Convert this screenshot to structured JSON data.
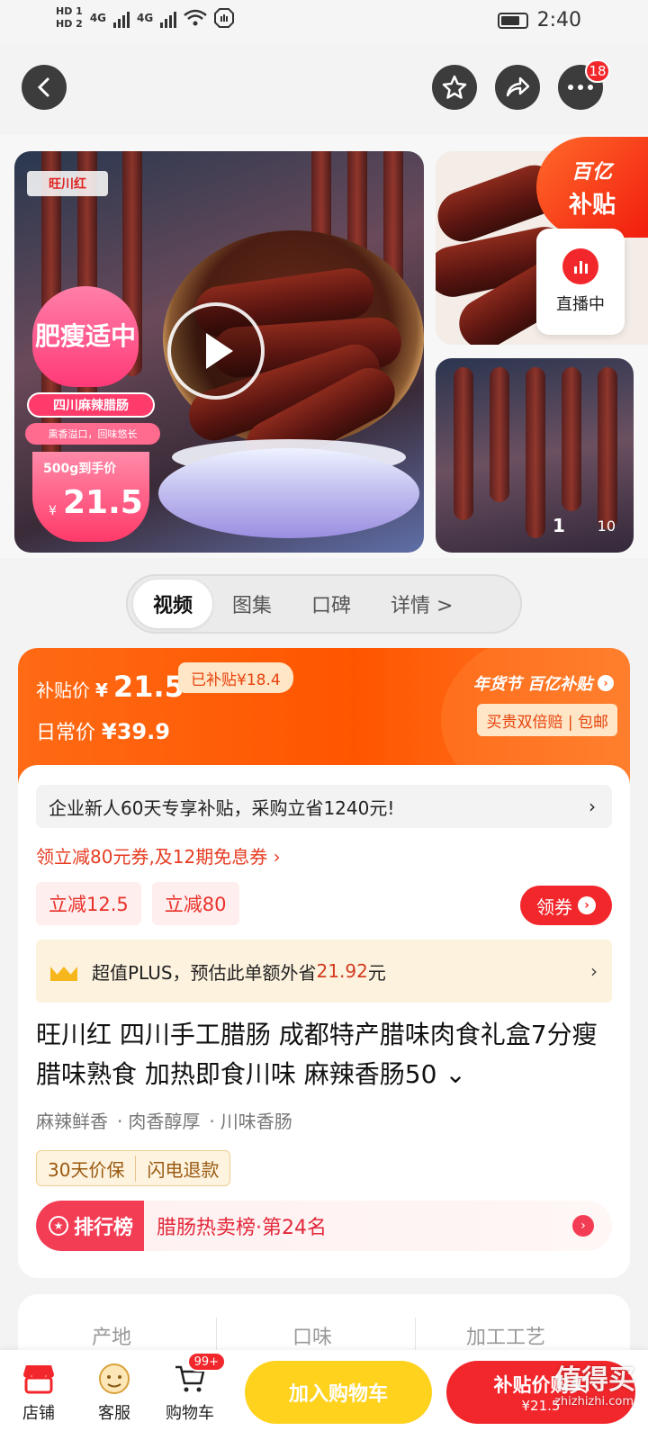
{
  "status_bar": {
    "hd1": "HD 1",
    "hd2": "HD 2",
    "net1": "4G",
    "net2": "4G",
    "time": "2:40"
  },
  "top_nav": {
    "badge_count": "18"
  },
  "gallery": {
    "brand_logo": "旺川红",
    "promo_tag": "肥瘦适中",
    "promo_title": "四川麻辣腊肠",
    "promo_sub": "熏香溢口，回味悠长",
    "promo_price_label": "500g到手价",
    "promo_currency": "¥",
    "promo_price": "21.5",
    "subsidy_top": "百亿",
    "subsidy_bottom": "补贴",
    "live_label": "直播中",
    "counter_current": "1",
    "counter_total": "10"
  },
  "tabs": [
    {
      "label": "视频",
      "active": true
    },
    {
      "label": "图集",
      "active": false
    },
    {
      "label": "口碑",
      "active": false
    },
    {
      "label": "详情 >",
      "active": false
    }
  ],
  "price_card": {
    "subsidy_label": "补贴价",
    "currency": "¥",
    "subsidy_price": "21.5",
    "subsidy_tag": "已补贴¥18.4",
    "regular_label": "日常价",
    "regular_price": "¥39.9",
    "brand_text": "年货节 百亿补贴",
    "guarantee": "买贵双倍赔 | 包邮"
  },
  "offers": {
    "new_user_text": "企业新人60天专享补贴，采购立省1240元!",
    "coupon_link": "领立减80元券,及12期免息券 ›",
    "chips": [
      "立减12.5",
      "立减80"
    ],
    "get_coupon": "领券",
    "plus_prefix": "超值PLUS，预估此单额外省",
    "plus_amount": "21.92",
    "plus_suffix": "元"
  },
  "product": {
    "title": "旺川红 四川手工腊肠 成都特产腊味肉食礼盒7分瘦腊味熟食 加热即食川味 麻辣香肠50 ⌄",
    "tags": [
      "麻辣鲜香",
      "肉香醇厚",
      "川味香肠"
    ],
    "services": [
      "30天价保",
      "闪电退款"
    ],
    "rank_label": "排行榜",
    "rank_text": "腊肠热卖榜·第24名"
  },
  "attributes": [
    "产地",
    "口味",
    "加工工艺"
  ],
  "bottom_bar": {
    "shop": "店铺",
    "service": "客服",
    "cart": "购物车",
    "cart_badge": "99+",
    "add_to_cart": "加入购物车",
    "buy_label": "补贴价购买",
    "buy_price": "¥21.5"
  },
  "watermark": {
    "text": "值得买",
    "url": "zhizhizhi.com"
  },
  "colors": {
    "accent_red": "#f2272c",
    "subsidy_orange": "#ff5500",
    "cart_yellow": "#ffd21e"
  }
}
